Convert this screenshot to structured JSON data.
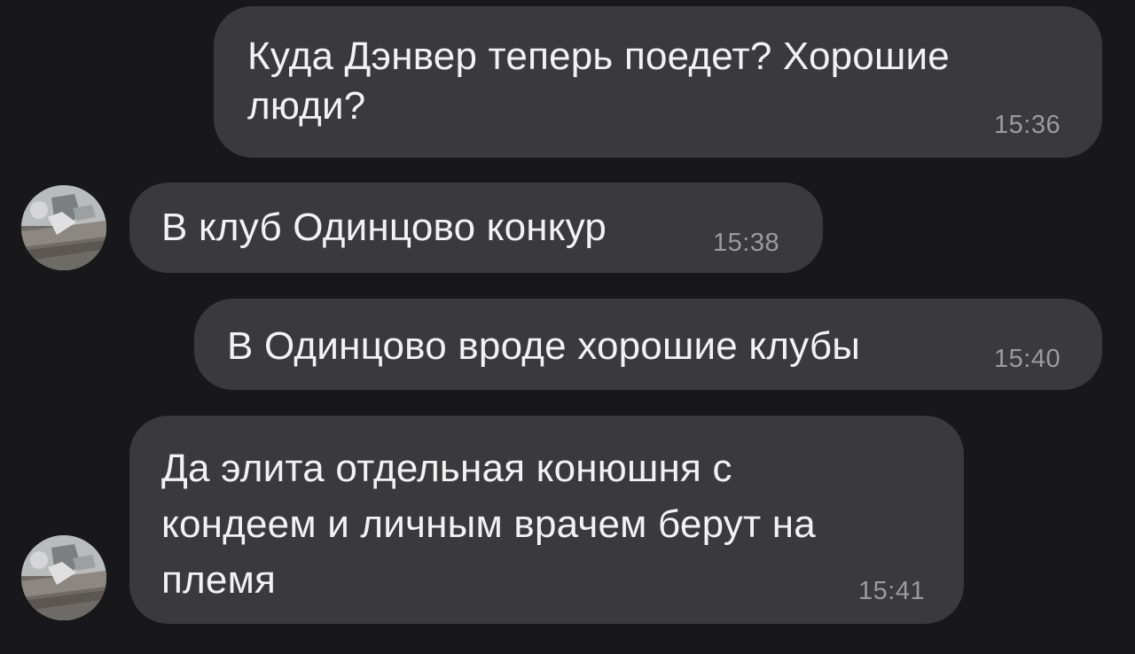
{
  "messages": [
    {
      "side": "outgoing",
      "text": "Куда Дэнвер теперь поедет? Хорошие\nлюди?",
      "time": "15:36"
    },
    {
      "side": "incoming",
      "text": "В клуб Одинцово конкур",
      "time": "15:38"
    },
    {
      "side": "outgoing",
      "text": "В Одинцово вроде хорошие клубы",
      "time": "15:40"
    },
    {
      "side": "incoming",
      "text": "Да элита отдельная конюшня с\nкондеем и личным врачем берут на\nплемя",
      "time": "15:41"
    }
  ],
  "avatar": {
    "icon": "contact-photo-avatar"
  },
  "colors": {
    "background": "#18181a",
    "bubble": "#3a3a3d",
    "text": "#f2f2f2",
    "time": "#9a9aa0"
  }
}
